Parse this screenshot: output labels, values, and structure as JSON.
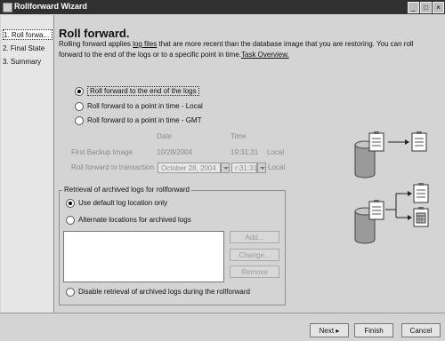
{
  "window": {
    "title": "Rollforward Wizard"
  },
  "sidebar": {
    "items": [
      {
        "label": "1. Roll forwa..."
      },
      {
        "label": "2. Final State"
      },
      {
        "label": "3. Summary"
      }
    ]
  },
  "main": {
    "heading": "Roll forward.",
    "desc_part1": "Rolling forward applies ",
    "desc_link1": "log files",
    "desc_part2": " that are more recent than the database image that you are restoring. You can roll forward to the end of the logs or to a specific point in time.",
    "desc_link2": "Task Overview.",
    "options": [
      "Roll forward to the end of the logs",
      "Roll forward to a point in time - Local",
      "Roll forward to a point in time - GMT"
    ],
    "col_date": "Date",
    "col_time": "Time",
    "first_backup_label": "First Backup Image",
    "first_backup_date": "10/28/2004",
    "first_backup_time": "19:31:31",
    "first_backup_zone": "Local",
    "rf_transaction_label": "Roll forward to transaction",
    "rf_date": "October 28, 2004",
    "rf_time": "r:31:31",
    "rf_zone": "Local",
    "retrieval": {
      "title": "Retrieval of archived logs for rollforward",
      "opt_default": "Use default log location only",
      "opt_alternate": "Alternate locations for archived logs",
      "add": "Add...",
      "change": "Change...",
      "remove": "Remove",
      "opt_disable": "Disable retrieval of archived logs during the rollforward"
    }
  },
  "footer": {
    "next": "Next",
    "finish": "Finish",
    "cancel": "Cancel"
  }
}
